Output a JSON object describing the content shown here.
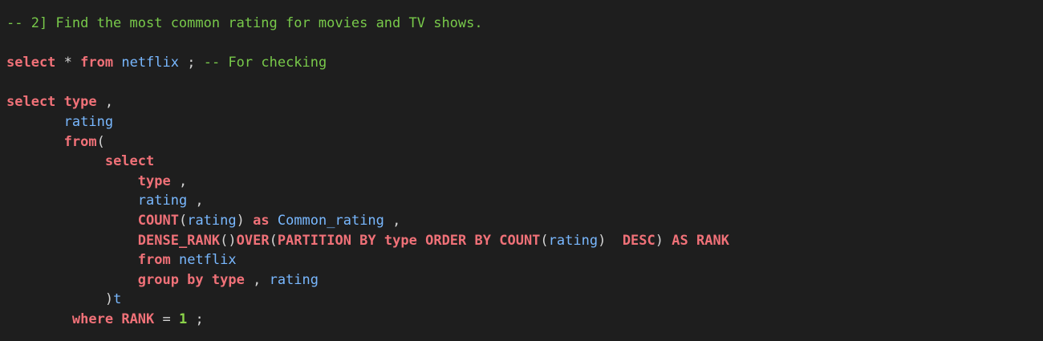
{
  "editor": {
    "lines": [
      {
        "indent": "",
        "tokens": [
          {
            "t": "comment",
            "v": "-- 2] Find the most common rating for movies and TV shows."
          }
        ]
      },
      {
        "indent": "",
        "tokens": []
      },
      {
        "indent": "",
        "tokens": [
          {
            "t": "keyword",
            "v": "select"
          },
          {
            "t": "op",
            "v": " * "
          },
          {
            "t": "keyword",
            "v": "from"
          },
          {
            "t": "plain",
            "v": " "
          },
          {
            "t": "ident",
            "v": "netflix"
          },
          {
            "t": "punct",
            "v": " ; "
          },
          {
            "t": "comment",
            "v": "-- For checking"
          }
        ]
      },
      {
        "indent": "",
        "tokens": []
      },
      {
        "indent": "",
        "tokens": [
          {
            "t": "keyword",
            "v": "select"
          },
          {
            "t": "plain",
            "v": " "
          },
          {
            "t": "keyword",
            "v": "type"
          },
          {
            "t": "punct",
            "v": " ,"
          }
        ]
      },
      {
        "indent": "       ",
        "tokens": [
          {
            "t": "ident",
            "v": "rating"
          }
        ]
      },
      {
        "indent": "       ",
        "tokens": [
          {
            "t": "keyword",
            "v": "from"
          },
          {
            "t": "punct",
            "v": "("
          }
        ]
      },
      {
        "indent": "            ",
        "tokens": [
          {
            "t": "keyword",
            "v": "select"
          }
        ]
      },
      {
        "indent": "                ",
        "tokens": [
          {
            "t": "keyword",
            "v": "type"
          },
          {
            "t": "punct",
            "v": " ,"
          }
        ]
      },
      {
        "indent": "                ",
        "tokens": [
          {
            "t": "ident",
            "v": "rating"
          },
          {
            "t": "punct",
            "v": " ,"
          }
        ]
      },
      {
        "indent": "                ",
        "tokens": [
          {
            "t": "keyword",
            "v": "COUNT"
          },
          {
            "t": "punct",
            "v": "("
          },
          {
            "t": "ident",
            "v": "rating"
          },
          {
            "t": "punct",
            "v": ") "
          },
          {
            "t": "keyword",
            "v": "as"
          },
          {
            "t": "plain",
            "v": " "
          },
          {
            "t": "ident",
            "v": "Common_rating"
          },
          {
            "t": "punct",
            "v": " ,"
          }
        ]
      },
      {
        "indent": "                ",
        "tokens": [
          {
            "t": "keyword",
            "v": "DENSE_RANK"
          },
          {
            "t": "punct",
            "v": "()"
          },
          {
            "t": "keyword",
            "v": "OVER"
          },
          {
            "t": "punct",
            "v": "("
          },
          {
            "t": "keyword",
            "v": "PARTITION BY"
          },
          {
            "t": "plain",
            "v": " "
          },
          {
            "t": "keyword",
            "v": "type"
          },
          {
            "t": "plain",
            "v": " "
          },
          {
            "t": "keyword",
            "v": "ORDER BY"
          },
          {
            "t": "plain",
            "v": " "
          },
          {
            "t": "keyword",
            "v": "COUNT"
          },
          {
            "t": "punct",
            "v": "("
          },
          {
            "t": "ident",
            "v": "rating"
          },
          {
            "t": "punct",
            "v": ")  "
          },
          {
            "t": "keyword",
            "v": "DESC"
          },
          {
            "t": "punct",
            "v": ") "
          },
          {
            "t": "keyword",
            "v": "AS"
          },
          {
            "t": "plain",
            "v": " "
          },
          {
            "t": "keyword",
            "v": "RANK"
          }
        ]
      },
      {
        "indent": "                ",
        "tokens": [
          {
            "t": "keyword",
            "v": "from"
          },
          {
            "t": "plain",
            "v": " "
          },
          {
            "t": "ident",
            "v": "netflix"
          }
        ]
      },
      {
        "indent": "                ",
        "tokens": [
          {
            "t": "keyword",
            "v": "group by"
          },
          {
            "t": "plain",
            "v": " "
          },
          {
            "t": "keyword",
            "v": "type"
          },
          {
            "t": "punct",
            "v": " , "
          },
          {
            "t": "ident",
            "v": "rating"
          }
        ]
      },
      {
        "indent": "            ",
        "tokens": [
          {
            "t": "punct",
            "v": ")"
          },
          {
            "t": "ident",
            "v": "t"
          }
        ]
      },
      {
        "indent": "        ",
        "tokens": [
          {
            "t": "keyword",
            "v": "where"
          },
          {
            "t": "plain",
            "v": " "
          },
          {
            "t": "keyword",
            "v": "RANK"
          },
          {
            "t": "op",
            "v": " = "
          },
          {
            "t": "number",
            "v": "1"
          },
          {
            "t": "punct",
            "v": " ;"
          }
        ]
      }
    ]
  },
  "colors": {
    "background": "#1e1e1e",
    "comment": "#78c94a",
    "keyword": "#f07178",
    "identifier": "#79b8ff",
    "number": "#8bd349",
    "punctuation": "#d4d4d4"
  }
}
